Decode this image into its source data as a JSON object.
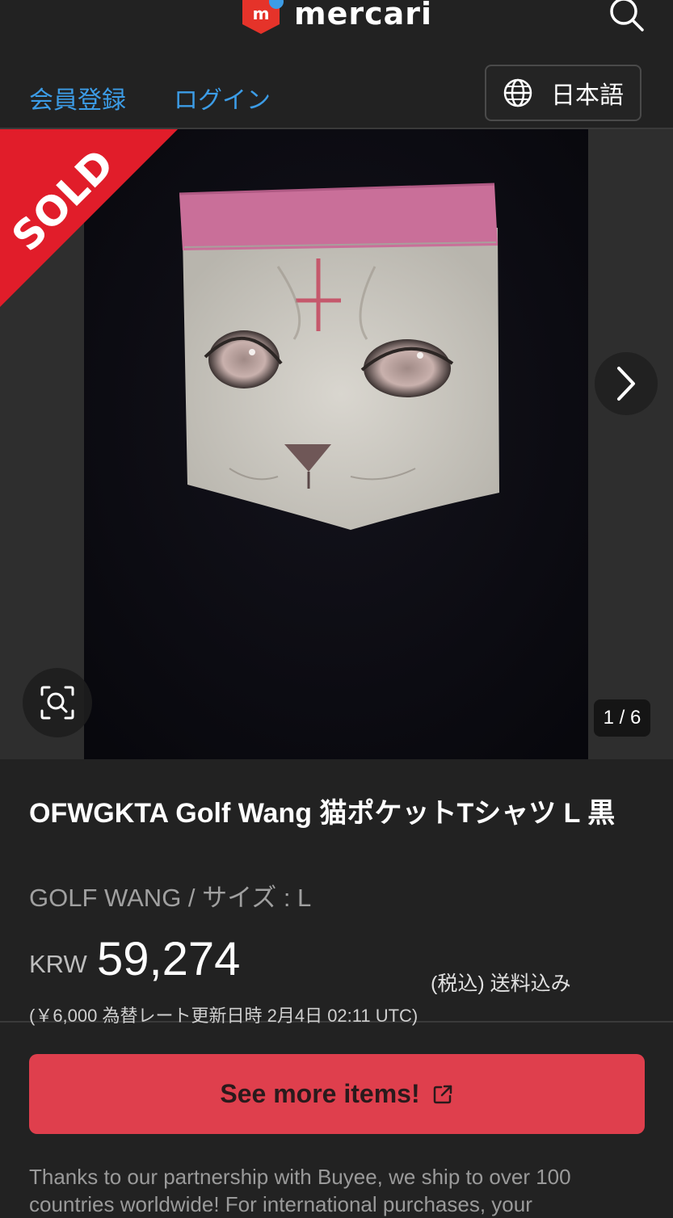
{
  "header": {
    "logo_text": "mercari",
    "logo_mark": "m",
    "search_icon": "search-icon",
    "accent_color": "#e5332a",
    "dot_color": "#3c9ce6"
  },
  "auth": {
    "register_label": "会員登録",
    "login_label": "ログイン",
    "language_label": "日本語",
    "language_icon": "globe-icon",
    "link_color": "#3c9ce6"
  },
  "gallery": {
    "sold_label": "SOLD",
    "counter": "1 / 6",
    "next_icon": "chevron-right-icon",
    "zoom_icon": "image-search-icon"
  },
  "item": {
    "title": "OFWGKTA Golf Wang 猫ポケットTシャツ L 黒",
    "subtitle": "GOLF WANG / サイズ : L",
    "currency": "KRW",
    "price": "59,274",
    "tax_note": "(税込) 送料込み",
    "rate_note": "(￥6,000 為替レート更新日時 2月4日 02:11 UTC)"
  },
  "cta": {
    "label": "See more items!",
    "icon": "external-link-icon",
    "color": "#df3f4d"
  },
  "partner": {
    "text": "Thanks to our partnership with Buyee, we ship to over 100 countries worldwide! For international purchases, your"
  }
}
